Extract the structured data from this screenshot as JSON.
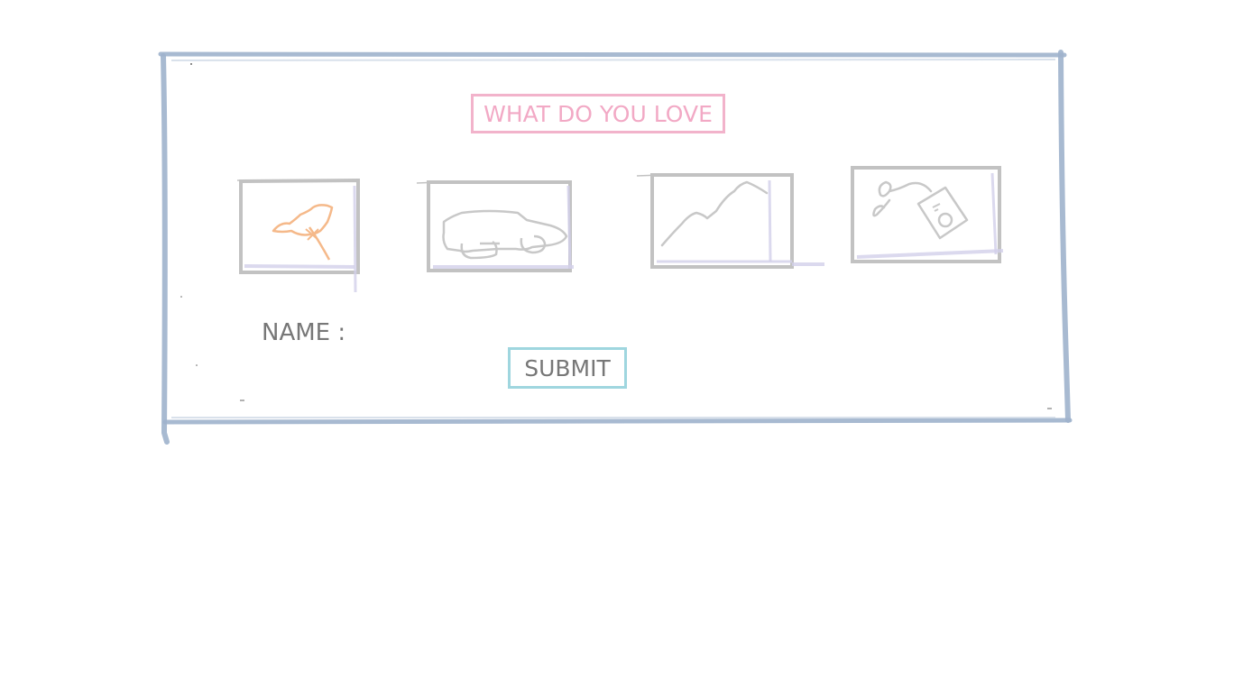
{
  "form": {
    "title": "WHAT DO YOU LOVE",
    "options": [
      {
        "icon": "bird-icon"
      },
      {
        "icon": "car-icon"
      },
      {
        "icon": "mountain-icon"
      },
      {
        "icon": "music-player-icon"
      }
    ],
    "name_label": "NAME :",
    "name_value": "",
    "submit_label": "SUBMIT"
  },
  "colors": {
    "frame": "#9fb3cc",
    "title": "#f2a9c5",
    "option_border": "#c2c2c2",
    "submit_border": "#9fd6df",
    "label_text": "#777777",
    "bird_stroke": "#f5b98a",
    "sketch_stroke": "#c8c8c8",
    "shadow_lavender": "#d3d0ea"
  }
}
